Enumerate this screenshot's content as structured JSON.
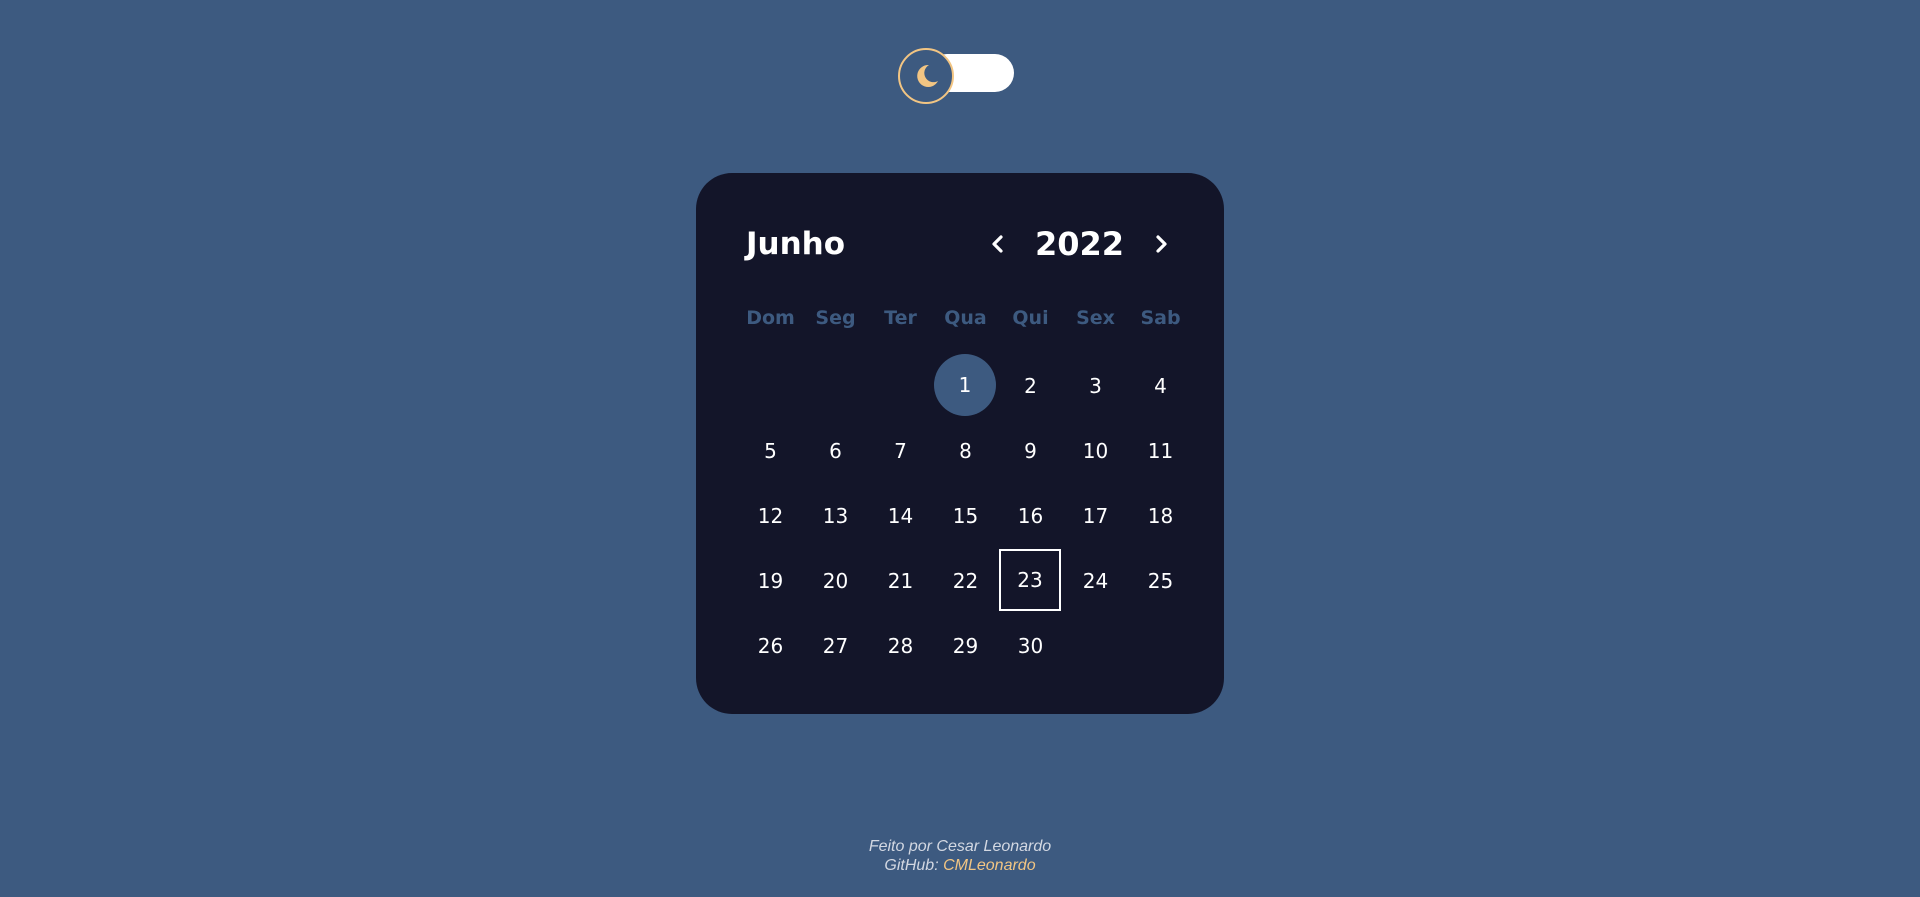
{
  "theme_toggle": {
    "icon": "moon-icon",
    "state": "dark"
  },
  "calendar": {
    "month": "Junho",
    "year": "2022",
    "prev_icon": "chevron-left-icon",
    "next_icon": "chevron-right-icon",
    "weekdays": [
      "Dom",
      "Seg",
      "Ter",
      "Qua",
      "Qui",
      "Sex",
      "Sab"
    ],
    "leading_blanks": 3,
    "days": [
      "1",
      "2",
      "3",
      "4",
      "5",
      "6",
      "7",
      "8",
      "9",
      "10",
      "11",
      "12",
      "13",
      "14",
      "15",
      "16",
      "17",
      "18",
      "19",
      "20",
      "21",
      "22",
      "23",
      "24",
      "25",
      "26",
      "27",
      "28",
      "29",
      "30"
    ],
    "selected_day": "1",
    "today": "23"
  },
  "footer": {
    "credit": "Feito por Cesar Leonardo",
    "github_label": "GitHub:",
    "github_link": "CMLeonardo"
  },
  "colors": {
    "background": "#3d5a80",
    "card": "#131529",
    "accent": "#f2c583",
    "weekday_text": "#3d5a80",
    "day_text": "#ffffff"
  }
}
